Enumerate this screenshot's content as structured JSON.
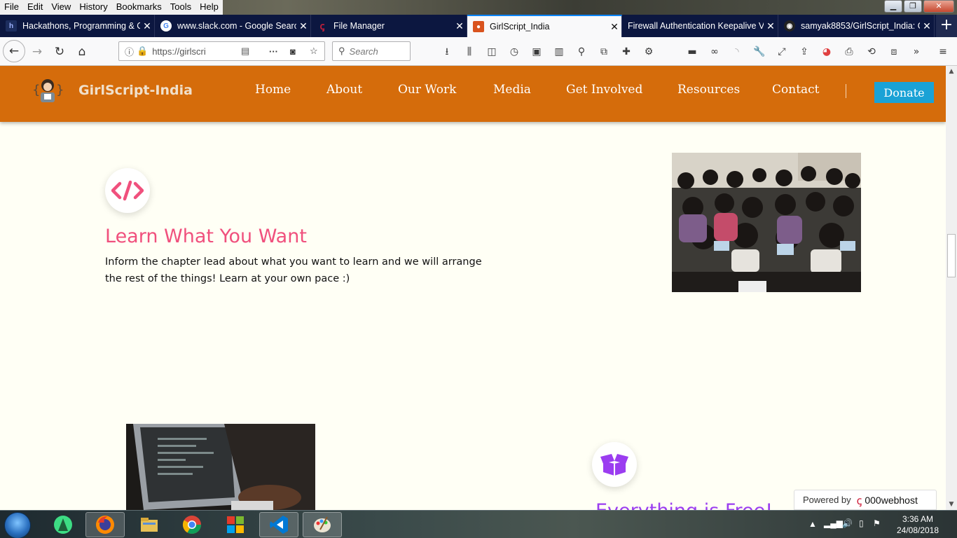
{
  "browser": {
    "menu": [
      "File",
      "Edit",
      "View",
      "History",
      "Bookmarks",
      "Tools",
      "Help"
    ],
    "window_buttons": {
      "minimize": "▁",
      "maximize": "❐",
      "close": "✕"
    },
    "tabs": [
      {
        "title": "Hackathons, Programming & C",
        "favicon": "hackerearth-icon",
        "color": "#1c2d5e"
      },
      {
        "title": "www.slack.com - Google Searc",
        "favicon": "google-icon",
        "color": "#ffffff"
      },
      {
        "title": "File Manager",
        "favicon": "000webhost-icon",
        "color": "#c0203b"
      },
      {
        "title": "GirlScript_India",
        "favicon": "girlscript-icon",
        "color": "#d9531e"
      },
      {
        "title": "Firewall Authentication Keepalive V",
        "favicon": "",
        "color": ""
      },
      {
        "title": "samyak8853/GirlScript_India: G",
        "favicon": "github-icon",
        "color": "#222222"
      }
    ],
    "new_tab": "+",
    "url": "https://girlscri",
    "search_placeholder": "Search"
  },
  "site": {
    "brand": "GirlScript-India",
    "nav": [
      "Home",
      "About",
      "Our Work",
      "Media",
      "Get Involved",
      "Resources",
      "Contact"
    ],
    "donate_label": "Donate",
    "header_color": "#d56c0b",
    "feature1": {
      "icon": "code-icon",
      "title": "Learn What You Want",
      "text_line1": "Inform the chapter lead about what you want to learn and we will arrange",
      "text_line2": "the rest of the things! Learn at your own pace :)",
      "color": "#f0507d"
    },
    "feature2": {
      "icon": "open-box-icon",
      "title": "Everything is Free!",
      "color": "#9b3df0"
    },
    "powered_label": "Powered by",
    "powered_brand": "000webhost"
  },
  "taskbar": {
    "apps": [
      "android-studio-icon",
      "firefox-icon",
      "file-explorer-icon",
      "chrome-icon",
      "office-icon",
      "vscode-icon",
      "paint-icon"
    ],
    "time": "3:36 AM",
    "date": "24/08/2018"
  }
}
